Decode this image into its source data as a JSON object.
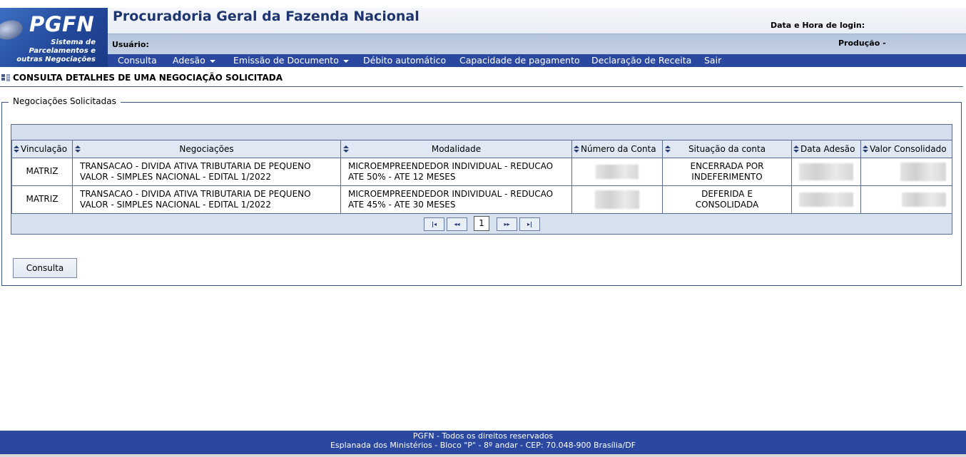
{
  "header": {
    "logo_brand": "PGFN",
    "logo_tagline": [
      "Sistema de",
      "Parcelamentos e",
      "outras Negociações"
    ],
    "title": "Procuradoria Geral da Fazenda Nacional",
    "login_label": "Data e Hora de login:",
    "user_label": "Usuário:",
    "environment_label": "Produção -"
  },
  "menu": {
    "items": [
      {
        "label": "Consulta",
        "dropdown": false
      },
      {
        "label": "Adesão",
        "dropdown": true
      },
      {
        "label": "Emissão de Documento",
        "dropdown": true
      },
      {
        "label": "Débito automático",
        "dropdown": false
      },
      {
        "label": "Capacidade de pagamento",
        "dropdown": false
      },
      {
        "label": "Declaração de Receita",
        "dropdown": false
      },
      {
        "label": "Sair",
        "dropdown": false
      }
    ]
  },
  "page": {
    "heading": "CONSULTA DETALHES DE UMA NEGOCIAÇÃO SOLICITADA",
    "fieldset_legend": "Negociações Solicitadas"
  },
  "table": {
    "columns": [
      "Vinculação",
      "Negociações",
      "Modalidade",
      "Número da Conta",
      "Situação da conta",
      "Data Adesão",
      "Valor Consolidado"
    ],
    "rows": [
      {
        "vinculacao": "MATRIZ",
        "negociacoes": "TRANSACAO - DIVIDA ATIVA TRIBUTARIA DE PEQUENO VALOR - SIMPLES NACIONAL - EDITAL 1/2022",
        "modalidade": "MICROEMPREENDEDOR INDIVIDUAL - REDUCAO ATE 50% - ATE 12 MESES",
        "situacao": "ENCERRADA POR INDEFERIMENTO"
      },
      {
        "vinculacao": "MATRIZ",
        "negociacoes": "TRANSACAO - DIVIDA ATIVA TRIBUTARIA DE PEQUENO VALOR - SIMPLES NACIONAL - EDITAL 1/2022",
        "modalidade": "MICROEMPREENDEDOR INDIVIDUAL - REDUCAO ATE 45% - ATE 30 MESES",
        "situacao": "DEFERIDA E CONSOLIDADA"
      }
    ]
  },
  "pager": {
    "first": "|◂",
    "prev": "◂◂",
    "current_page": "1",
    "next": "▸▸",
    "last": "▸|"
  },
  "actions": {
    "consulta_button": "Consulta"
  },
  "footer": {
    "line1": "PGFN - Todos os direitos reservados",
    "line2": "Esplanada dos Ministérios - Bloco \"P\" - 8º andar - CEP: 70.048-900 Brasília/DF"
  },
  "colors": {
    "menu_bar": "#2b48a0",
    "title_text": "#1e3570",
    "table_border": "#5a6a90"
  }
}
